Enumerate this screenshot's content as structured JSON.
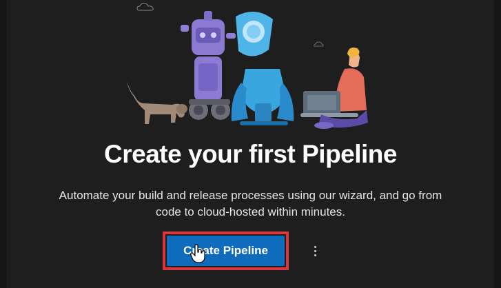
{
  "empty_state": {
    "title": "Create your first Pipeline",
    "description_line1": "Automate your build and release processes using our wizard, and go from",
    "description_line2": "code to cloud-hosted within minutes."
  },
  "actions": {
    "create_label": "Create Pipeline",
    "more_icon": "more-vertical-icon"
  },
  "colors": {
    "background": "#1e1e1e",
    "primary_button": "#0f6cbd",
    "highlight_border": "#d9363e"
  }
}
